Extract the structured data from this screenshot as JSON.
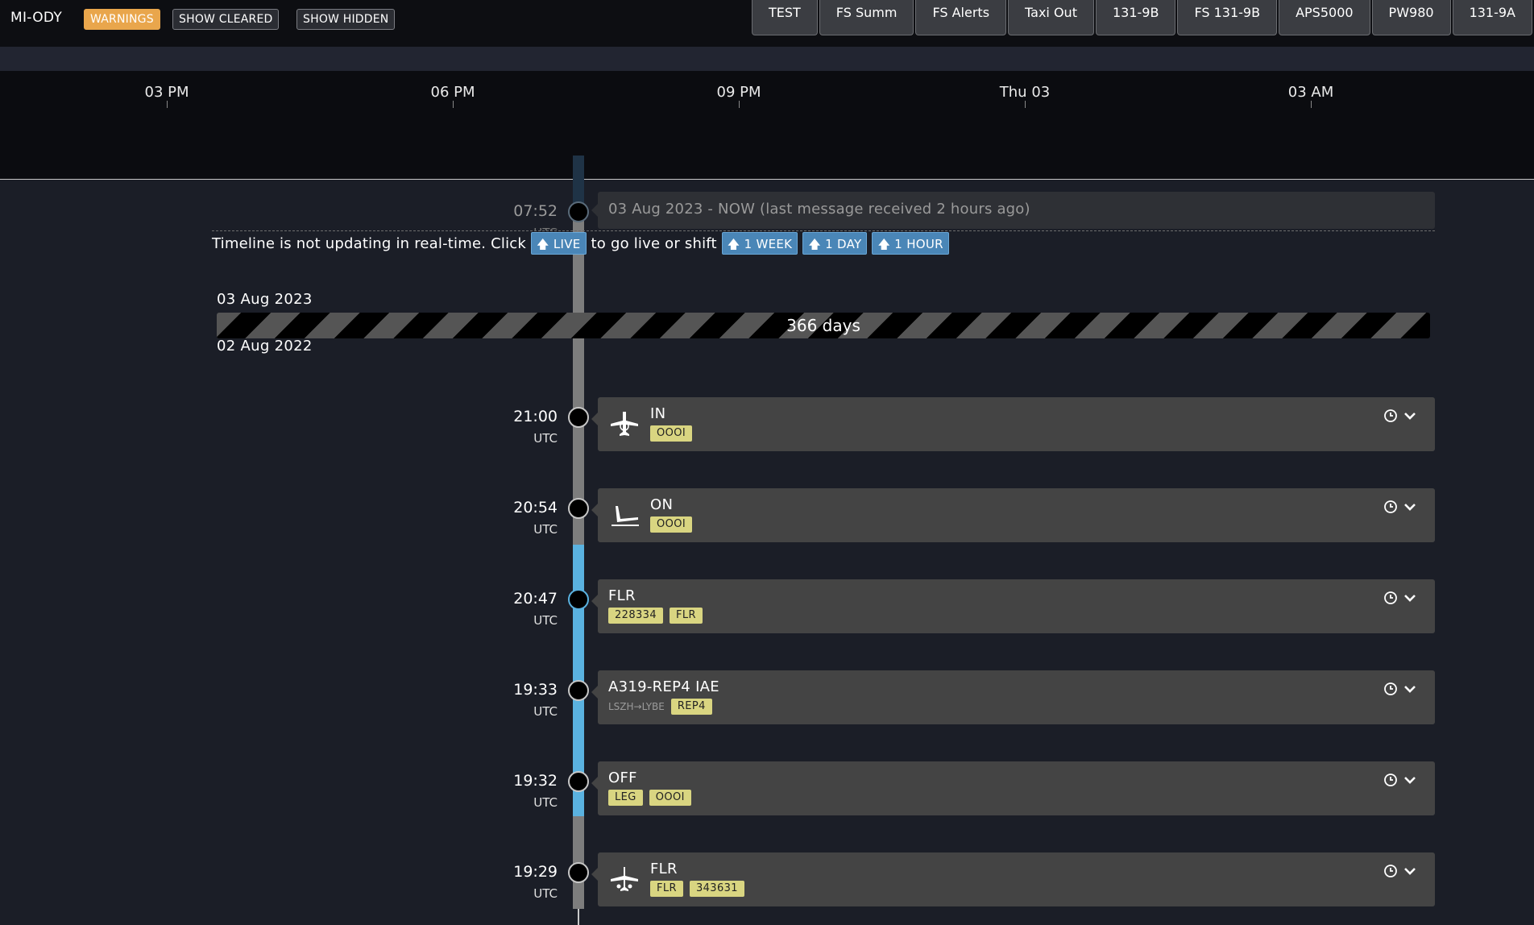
{
  "header": {
    "registration": "MI-ODY",
    "filters": [
      {
        "label": "WARNINGS"
      },
      {
        "label": "SHOW CLEARED"
      },
      {
        "label": "SHOW HIDDEN"
      }
    ],
    "tabs": [
      "TEST",
      "FS Summ",
      "FS Alerts",
      "Taxi Out",
      "131-9B",
      "FS 131-9B",
      "APS5000",
      "PW980",
      "131-9A"
    ]
  },
  "axis": {
    "ticks": [
      "03 PM",
      "06 PM",
      "09 PM",
      "Thu 03",
      "03 AM"
    ]
  },
  "now": {
    "time": "07:52",
    "tz": "UTC",
    "text": "03 Aug 2023 - NOW (last message received 2 hours ago)"
  },
  "notice": {
    "prefix": "Timeline is not updating in real-time. Click",
    "live_label": "LIVE",
    "middle": "to go live or shift",
    "shift_week": "1 WEEK",
    "shift_day": "1 DAY",
    "shift_hour": "1 HOUR"
  },
  "gap": {
    "date_end": "03 Aug 2023",
    "date_start": "02 Aug 2022",
    "duration": "366 days"
  },
  "events": [
    {
      "time": "21:00",
      "tz": "UTC",
      "title": "IN",
      "icon": "plane-parked-icon",
      "tags": [
        "OOOI"
      ]
    },
    {
      "time": "20:54",
      "tz": "UTC",
      "title": "ON",
      "icon": "plane-landing-icon",
      "tags": [
        "OOOI"
      ]
    },
    {
      "time": "20:47",
      "tz": "UTC",
      "title": "FLR",
      "tags": [
        "228334",
        "FLR"
      ]
    },
    {
      "time": "19:33",
      "tz": "UTC",
      "title": "A319-REP4 IAE",
      "route": "LSZH→LYBE",
      "tags": [
        "REP4"
      ]
    },
    {
      "time": "19:32",
      "tz": "UTC",
      "title": "OFF",
      "tags": [
        "LEG",
        "OOOI"
      ]
    },
    {
      "time": "19:29",
      "tz": "UTC",
      "title": "FLR",
      "icon": "plane-fault-icon",
      "tags": [
        "FLR",
        "343631"
      ]
    }
  ],
  "colors": {
    "warnings": "#e9a64c",
    "tag": "#d9d581",
    "rail_active": "#5ab2e0",
    "shift_button": "#4a86b7"
  }
}
